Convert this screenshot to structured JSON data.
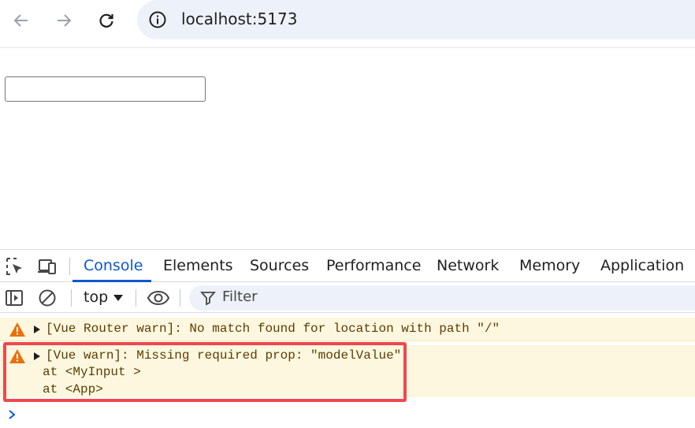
{
  "browser": {
    "url": "localhost:5173"
  },
  "devtools": {
    "tabs": [
      "Console",
      "Elements",
      "Sources",
      "Performance",
      "Network",
      "Memory",
      "Application"
    ],
    "active_tab": "Console",
    "context": "top",
    "filter_placeholder": "Filter",
    "messages": [
      {
        "level": "warning",
        "lines": [
          "[Vue Router warn]: No match found for location with path \"/\""
        ]
      },
      {
        "level": "warning",
        "lines": [
          "[Vue warn]: Missing required prop: \"modelValue\"",
          "at <MyInput >",
          "at <App>"
        ]
      }
    ]
  },
  "colors": {
    "accent": "#0b57d0",
    "warning_bg": "#fef7e0",
    "warning_icon": "#e8710a",
    "highlight": "#f0474d"
  }
}
